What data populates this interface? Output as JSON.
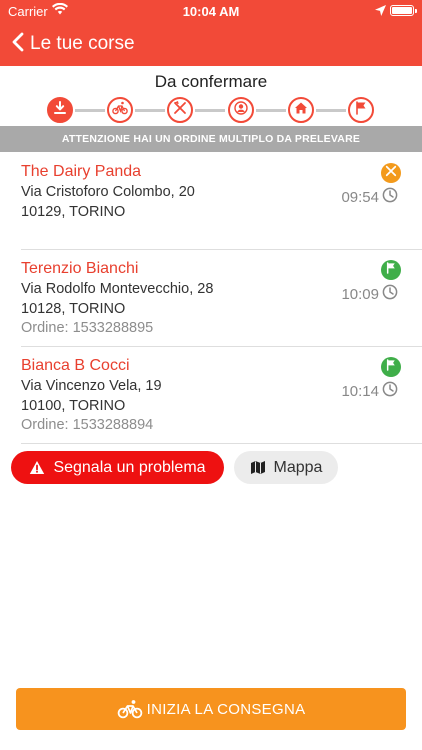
{
  "status_bar": {
    "carrier": "Carrier",
    "time": "10:04 AM"
  },
  "nav": {
    "back_label": "Le tue corse"
  },
  "status": {
    "title": "Da confermare"
  },
  "steps": [
    {
      "icon": "download-icon",
      "active": true
    },
    {
      "icon": "bicycle-icon",
      "active": false
    },
    {
      "icon": "fork-knife-icon",
      "active": false
    },
    {
      "icon": "person-icon",
      "active": false
    },
    {
      "icon": "home-icon",
      "active": false
    },
    {
      "icon": "flag-icon",
      "active": false
    }
  ],
  "notice": "ATTENZIONE HAI UN ORDINE MULTIPLO DA PRELEVARE",
  "orders": [
    {
      "name": "The Dairy Panda",
      "street": "Via Cristoforo Colombo, 20",
      "city": "10129, TORINO",
      "order_number": "",
      "time": "09:54",
      "icon": "fork-knife-icon",
      "icon_color": "#f39a1c"
    },
    {
      "name": "Terenzio Bianchi",
      "street": "Via Rodolfo Montevecchio, 28",
      "city": "10128, TORINO",
      "order_number": "Ordine: 1533288895",
      "time": "10:09",
      "icon": "flag-icon",
      "icon_color": "#3fae49"
    },
    {
      "name": "Bianca B Cocci",
      "street": "Via Vincenzo Vela, 19",
      "city": "10100, TORINO",
      "order_number": "Ordine: 1533288894",
      "time": "10:14",
      "icon": "flag-icon",
      "icon_color": "#3fae49"
    }
  ],
  "actions": {
    "report_label": "Segnala un problema",
    "map_label": "Mappa"
  },
  "footer": {
    "start_label": "INIZIA LA CONSEGNA"
  },
  "colors": {
    "brand": "#f24a38",
    "report": "#ee1111",
    "start": "#f7931e"
  }
}
